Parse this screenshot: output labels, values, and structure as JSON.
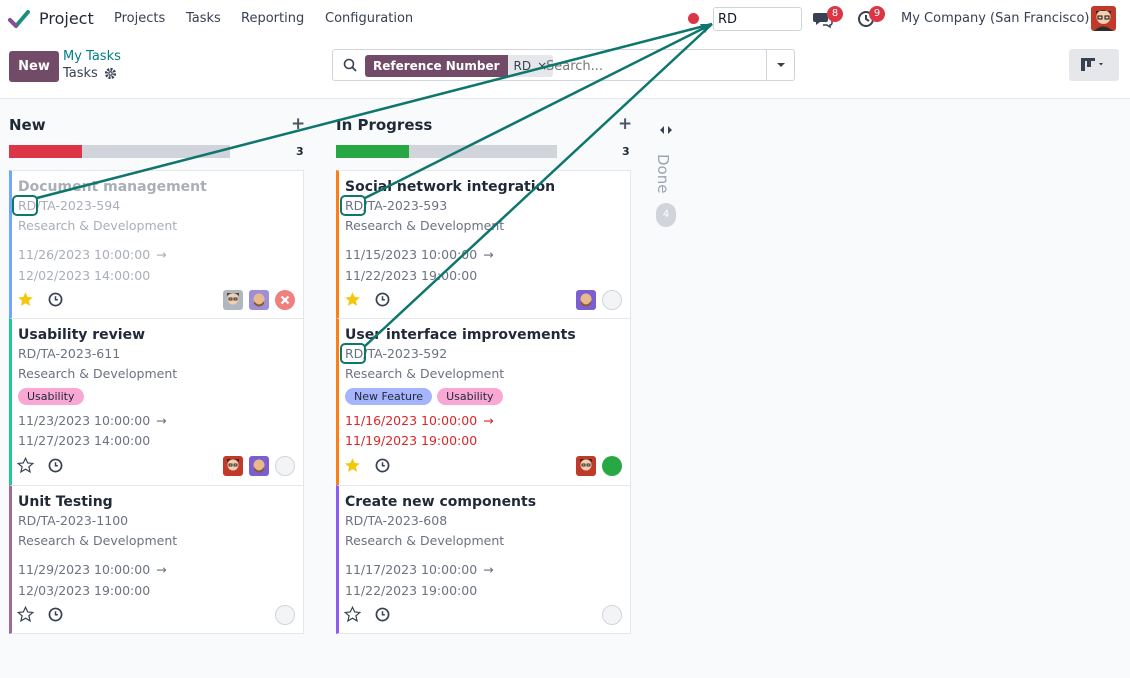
{
  "nav": {
    "app_name": "Project",
    "menu": [
      "Projects",
      "Tasks",
      "Reporting",
      "Configuration"
    ],
    "input_value": "RD",
    "messages_badge": "8",
    "activity_badge": "9",
    "company": "My Company (San Francisco)"
  },
  "control": {
    "new_label": "New",
    "breadcrumb_parent": "My Tasks",
    "breadcrumb_current": "Tasks",
    "search": {
      "facet_label": "Reference Number",
      "facet_value": "RD",
      "facet_remove": "×",
      "placeholder": "Search..."
    }
  },
  "columns": [
    {
      "title": "New",
      "count": "3",
      "plus": "+",
      "progress_fraction": 0.33,
      "progress_color": "#dc3545"
    },
    {
      "title": "In Progress",
      "count": "3",
      "plus": "+",
      "progress_fraction": 0.33,
      "progress_color": "#28a745"
    }
  ],
  "done_column": {
    "title": "Done",
    "count": "4"
  },
  "cards": {
    "c1": {
      "title": "Document management",
      "ref": "RD/TA-2023-594",
      "project": "Research & Development",
      "date_start": "11/26/2023 10:00:00",
      "date_end": "12/02/2023 14:00:00",
      "starred": true,
      "state": "blocked",
      "color": "#6ea8fe"
    },
    "c2": {
      "title": "Usability review",
      "ref": "RD/TA-2023-611",
      "project": "Research & Development",
      "tag1": "Usability",
      "date_start": "11/23/2023 10:00:00",
      "date_end": "11/27/2023 14:00:00",
      "starred": false,
      "state": "normal",
      "color": "#20c997"
    },
    "c3": {
      "title": "Unit Testing",
      "ref": "RD/TA-2023-1100",
      "project": "Research & Development",
      "date_start": "11/29/2023 10:00:00",
      "date_end": "12/03/2023 19:00:00",
      "starred": false,
      "state": "normal",
      "color": "#a06b9a"
    },
    "c4": {
      "title": "Social network integration",
      "ref": "RD/TA-2023-593",
      "project": "Research & Development",
      "date_start": "11/15/2023 10:00:00",
      "date_end": "11/22/2023 19:00:00",
      "starred": true,
      "state": "normal",
      "color": "#fd7e14"
    },
    "c5": {
      "title": "User interface improvements",
      "ref": "RD/TA-2023-592",
      "project": "Research & Development",
      "tag1": "New Feature",
      "tag2": "Usability",
      "date_start": "11/16/2023 10:00:00",
      "date_end": "11/19/2023 19:00:00",
      "starred": true,
      "state": "done",
      "color": "#fd7e14"
    },
    "c6": {
      "title": "Create new components",
      "ref": "RD/TA-2023-608",
      "project": "Research & Development",
      "date_start": "11/17/2023 10:00:00",
      "date_end": "11/22/2023 19:00:00",
      "starred": false,
      "state": "normal",
      "color": "#8b5cf6"
    }
  },
  "arrow_glyph": "→",
  "annotation_color": "#0f766e"
}
